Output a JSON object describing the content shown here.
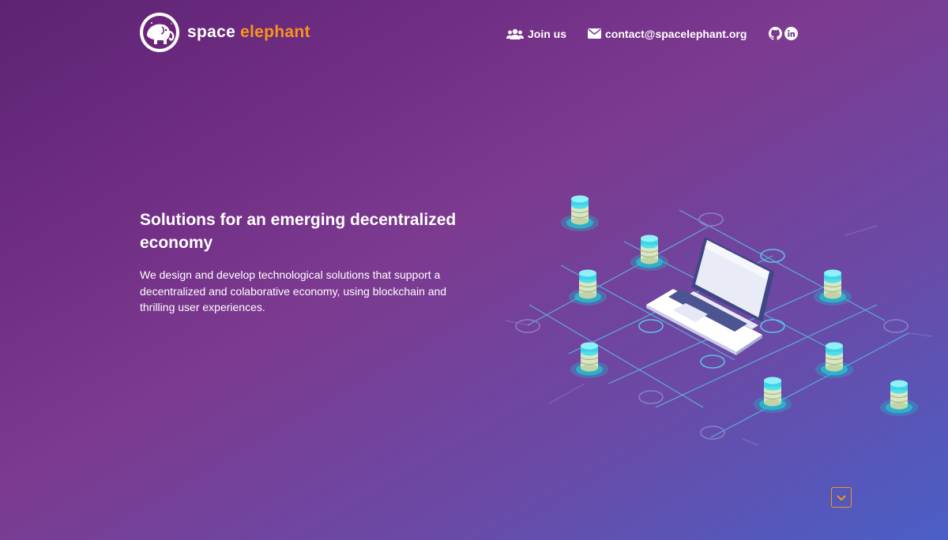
{
  "brand": {
    "name_part1": "space",
    "name_part2": "elephant",
    "accent_color": "#f7941d",
    "icon": "elephant-logo-icon"
  },
  "nav": {
    "join": {
      "label": "Join us",
      "icon": "users-icon"
    },
    "contact": {
      "label": "contact@spacelephant.org",
      "icon": "envelope-icon"
    },
    "social": [
      {
        "icon": "github-icon"
      },
      {
        "icon": "linkedin-icon"
      }
    ]
  },
  "hero": {
    "title": "Solutions for an emerging decentralized economy",
    "description": "We design and develop technological solutions that support a decentralized and colaborative economy, using blockchain and thrilling user experiences."
  },
  "illustration": {
    "subject": "laptop-connected-to-blockchain-nodes"
  },
  "scroll_down": {
    "icon": "chevron-down-icon"
  }
}
